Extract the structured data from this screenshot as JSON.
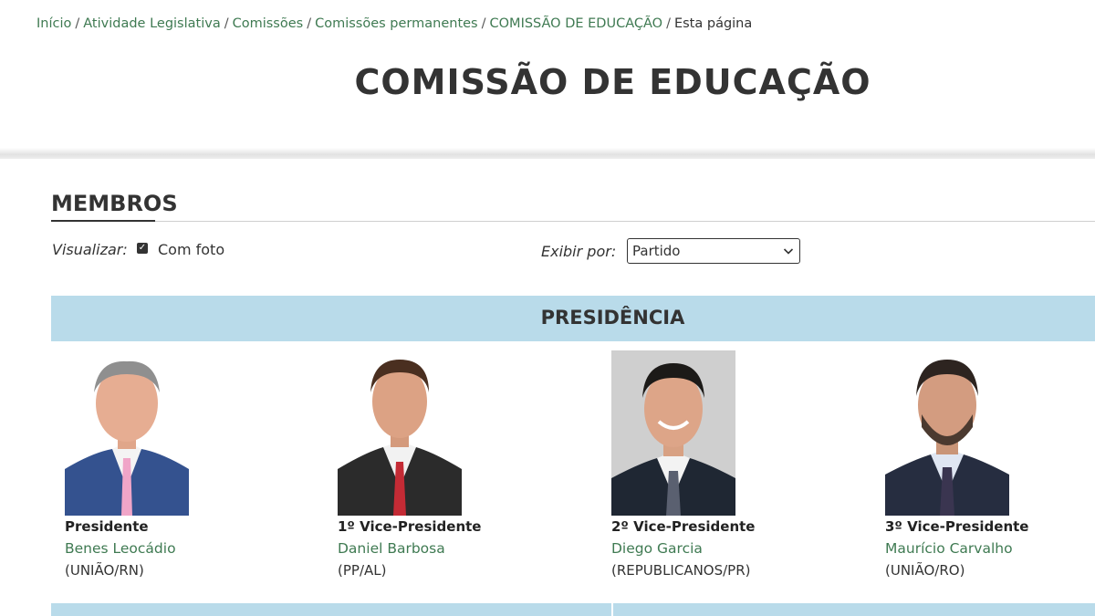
{
  "breadcrumb": {
    "items": [
      "Início",
      "Atividade Legislativa",
      "Comissões",
      "Comissões permanentes",
      "COMISSÃO DE EDUCAÇÃO"
    ],
    "current": "Esta página",
    "separator": "/"
  },
  "page": {
    "title": "COMISSÃO DE EDUCAÇÃO"
  },
  "section": {
    "title": "MEMBROS"
  },
  "controls": {
    "view_label": "Visualizar:",
    "with_photo_label": "Com foto",
    "with_photo_checked": true,
    "show_by_label": "Exibir por:",
    "show_by_value": "Partido"
  },
  "presidency": {
    "title": "PRESIDÊNCIA",
    "members": [
      {
        "role": "Presidente",
        "name": "Benes Leocádio",
        "party": "(UNIÃO/RN)"
      },
      {
        "role": "1º Vice-Presidente",
        "name": "Daniel Barbosa",
        "party": "(PP/AL)"
      },
      {
        "role": "2º Vice-Presidente",
        "name": "Diego Garcia",
        "party": "(REPUBLICANOS/PR)"
      },
      {
        "role": "3º Vice-Presidente",
        "name": "Maurício Carvalho",
        "party": "(UNIÃO/RO)"
      }
    ]
  },
  "colors": {
    "link": "#3f7a52",
    "band": "#b9dbea",
    "text": "#333333"
  }
}
